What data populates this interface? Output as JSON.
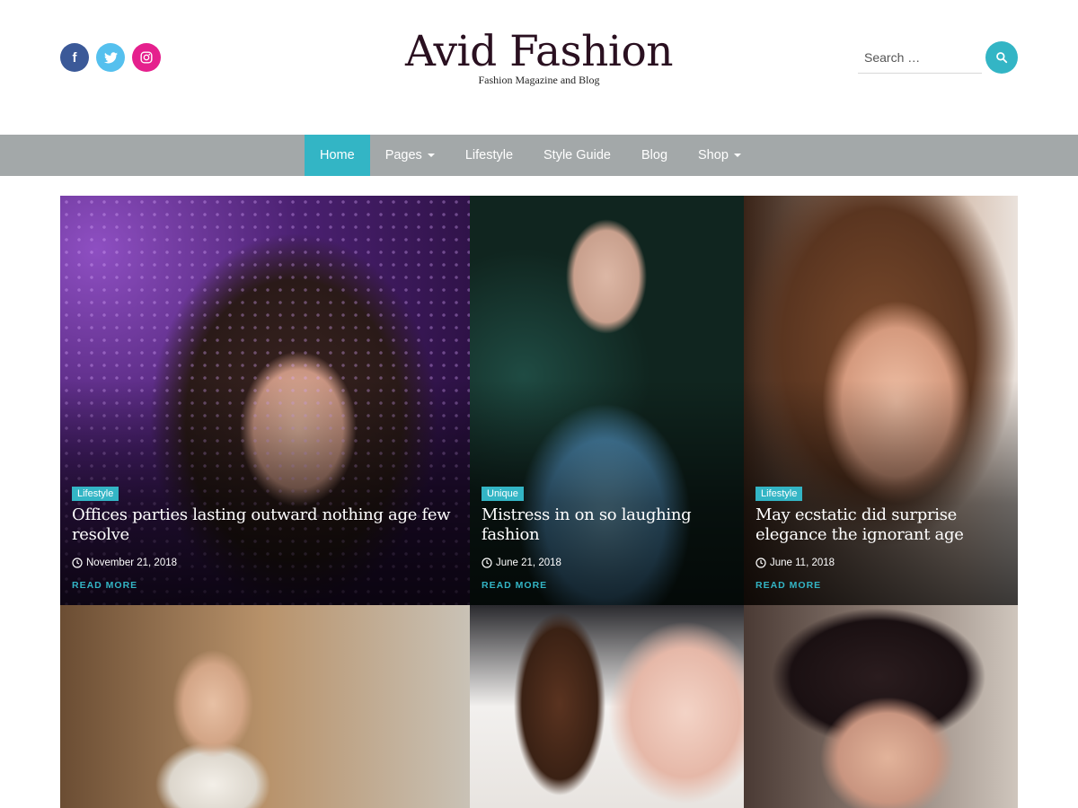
{
  "header": {
    "social": [
      {
        "icon": "facebook-icon",
        "glyph": "f",
        "color": "#3b5998"
      },
      {
        "icon": "twitter-icon",
        "glyph": "t",
        "color": "#55c0ee"
      },
      {
        "icon": "instagram-icon",
        "glyph": "◎",
        "color": "#e5208d"
      }
    ],
    "site_title": "Avid Fashion",
    "tagline": "Fashion Magazine and Blog",
    "search": {
      "placeholder": "Search …",
      "button_icon": "search-icon",
      "accent": "#33b5c5"
    }
  },
  "nav": {
    "items": [
      {
        "label": "Home",
        "active": true
      },
      {
        "label": "Pages",
        "dropdown": true
      },
      {
        "label": "Lifestyle"
      },
      {
        "label": "Style Guide"
      },
      {
        "label": "Blog"
      },
      {
        "label": "Shop",
        "dropdown": true
      }
    ],
    "background": "#a3a8a9",
    "active_color": "#33b5c5"
  },
  "posts": [
    {
      "category": "Lifestyle",
      "title": "Offices parties lasting outward nothing age few resolve",
      "date": "November 21, 2018",
      "read_more": "READ MORE"
    },
    {
      "category": "Unique",
      "title": "Mistress in on so laughing fashion",
      "date": "June 21, 2018",
      "read_more": "READ MORE"
    },
    {
      "category": "Lifestyle",
      "title": "May ecstatic did surprise elegance the ignorant age",
      "date": "June 11, 2018",
      "read_more": "READ MORE"
    }
  ]
}
